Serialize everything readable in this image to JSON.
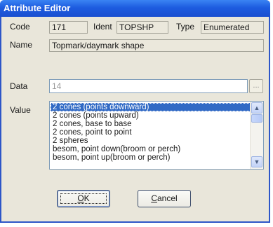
{
  "window": {
    "title": "Attribute Editor"
  },
  "fields": {
    "code_label": "Code",
    "code_value": "171",
    "ident_label": "Ident",
    "ident_value": "TOPSHP",
    "type_label": "Type",
    "type_value": "Enumerated",
    "name_label": "Name",
    "name_value": "Topmark/daymark shape",
    "data_label": "Data",
    "data_value": "14",
    "data_browse_label": "...",
    "value_label": "Value"
  },
  "value_list": {
    "selected_index": 0,
    "items": [
      "2 cones (points downward)",
      "2 cones (points upward)",
      "2 cones, base to base",
      "2 cones, point to point",
      "2 spheres",
      "besom, point down(broom or perch)",
      "besom, point up(broom or perch)"
    ]
  },
  "buttons": {
    "ok_accel": "O",
    "ok_rest": "K",
    "cancel_accel": "C",
    "cancel_rest": "ancel"
  },
  "colors": {
    "titlebar": "#1d5ce0",
    "selection": "#316ac5",
    "dialog_bg": "#e9e6da"
  },
  "icons": {
    "scroll_up": "▲",
    "scroll_down": "▼"
  }
}
